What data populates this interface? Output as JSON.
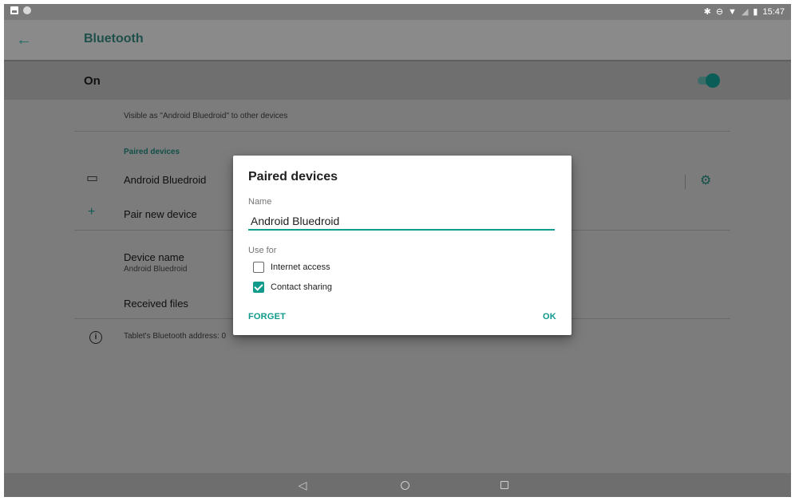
{
  "status_bar": {
    "time": "15:47"
  },
  "header": {
    "title": "Bluetooth"
  },
  "toggle": {
    "label": "On",
    "enabled": true
  },
  "content": {
    "visible_as": "Visible as \"Android Bluedroid\" to other devices",
    "paired_header": "Paired devices",
    "paired_device_name": "Android Bluedroid",
    "pair_new": "Pair new device",
    "device_name_title": "Device name",
    "device_name_value": "Android Bluedroid",
    "received_files": "Received files",
    "address_text": "Tablet's Bluetooth address: 0"
  },
  "dialog": {
    "title": "Paired devices",
    "name_label": "Name",
    "name_value": "Android Bluedroid",
    "use_for_label": "Use for",
    "options": [
      {
        "label": "Internet access",
        "checked": false
      },
      {
        "label": "Contact sharing",
        "checked": true
      }
    ],
    "forget_label": "FORGET",
    "ok_label": "OK"
  },
  "colors": {
    "accent": "#0f9a8b"
  }
}
